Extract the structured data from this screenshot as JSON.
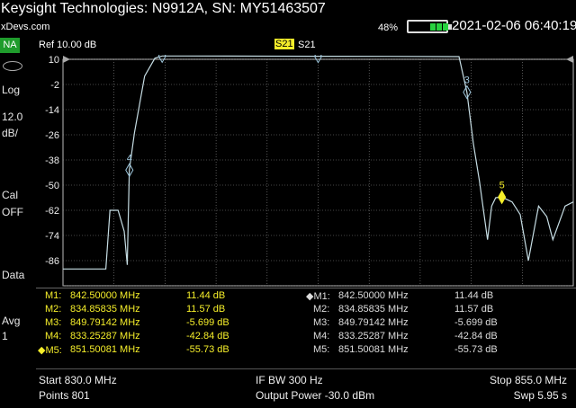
{
  "title": "Keysight Technologies: N9912A, SN: MY51463507",
  "site": "xDevs.com",
  "status": {
    "battery_pct": "48%",
    "battery_level": 0.48,
    "datetime": "2021-02-06 06:40:19"
  },
  "left_panel": {
    "mode": "NA",
    "scale_mode": "Log",
    "scale_value": "12.0",
    "scale_unit": "dB/",
    "cal_label": "Cal",
    "cal_state": "OFF",
    "data_label": "Data",
    "avg_label": "Avg",
    "avg_value": "1"
  },
  "header": {
    "ref": "Ref 10.00 dB",
    "active_trace": "S21",
    "trace": "S21"
  },
  "colors": {
    "trace": "#c6dde4",
    "marker_active": "#f5ee2a",
    "marker_normal": "#9ec7dd",
    "marker_table": "#f5ee2a",
    "grid": "#8c8c8c",
    "mode_badge": "#1f9c2c"
  },
  "chart_data": {
    "type": "line",
    "ylabel": "dB",
    "ylim": [
      -98,
      10
    ],
    "xlim": [
      830.0,
      855.0
    ],
    "y_ticks": [
      "10",
      "-2",
      "-14",
      "-26",
      "-38",
      "-50",
      "-62",
      "-74",
      "-86"
    ],
    "series": [
      {
        "name": "S21",
        "x": [
          830.0,
          832.1,
          832.3,
          832.7,
          833.0,
          833.15,
          833.25,
          833.5,
          834.0,
          834.5,
          834.86,
          836.0,
          840.0,
          842.5,
          846.0,
          849.4,
          849.79,
          850.1,
          850.4,
          850.8,
          851.0,
          851.2,
          851.5,
          852.0,
          852.4,
          852.8,
          853.3,
          853.7,
          854.0,
          854.6,
          855.0
        ],
        "values": [
          -90,
          -90,
          -62,
          -62,
          -72,
          -88,
          -42.8,
          -25,
          2,
          10.5,
          11.57,
          11.6,
          11.5,
          11.44,
          11.4,
          11.3,
          -5.7,
          -30,
          -48,
          -76,
          -60,
          -56,
          -55.7,
          -58,
          -64,
          -86,
          -60,
          -65,
          -76,
          -60,
          -58
        ]
      }
    ],
    "markers": [
      {
        "label": "1",
        "freq": 842.5,
        "value": 11.44,
        "active": false
      },
      {
        "label": "2",
        "freq": 834.85835,
        "value": 11.57,
        "active": false
      },
      {
        "label": "3",
        "freq": 849.79142,
        "value": -5.699,
        "active": false
      },
      {
        "label": "4",
        "freq": 833.25287,
        "value": -42.84,
        "active": false
      },
      {
        "label": "5",
        "freq": 851.50081,
        "value": -55.73,
        "active": true
      }
    ]
  },
  "marker_table": {
    "left": [
      {
        "name": "M1:",
        "freq": "842.50000 MHz",
        "value": "11.44 dB",
        "active": false
      },
      {
        "name": "M2:",
        "freq": "834.85835 MHz",
        "value": "11.57 dB",
        "active": false
      },
      {
        "name": "M3:",
        "freq": "849.79142 MHz",
        "value": "-5.699 dB",
        "active": false
      },
      {
        "name": "M4:",
        "freq": "833.25287 MHz",
        "value": "-42.84 dB",
        "active": false
      },
      {
        "name": "M5:",
        "freq": "851.50081 MHz",
        "value": "-55.73 dB",
        "active": true
      }
    ],
    "right": [
      {
        "name": "M1:",
        "freq": "842.50000 MHz",
        "value": "11.44 dB",
        "active": true
      },
      {
        "name": "M2:",
        "freq": "834.85835 MHz",
        "value": "11.57 dB",
        "active": false
      },
      {
        "name": "M3:",
        "freq": "849.79142 MHz",
        "value": "-5.699 dB",
        "active": false
      },
      {
        "name": "M4:",
        "freq": "833.25287 MHz",
        "value": "-42.84 dB",
        "active": false
      },
      {
        "name": "M5:",
        "freq": "851.50081 MHz",
        "value": "-55.73 dB",
        "active": false
      }
    ]
  },
  "footer": {
    "start": "Start 830.0 MHz",
    "ifbw": "IF BW 300 Hz",
    "stop": "Stop 855.0 MHz",
    "points": "Points 801",
    "power": "Output Power -30.0 dBm",
    "sweep": "Swp 5.95 s"
  }
}
